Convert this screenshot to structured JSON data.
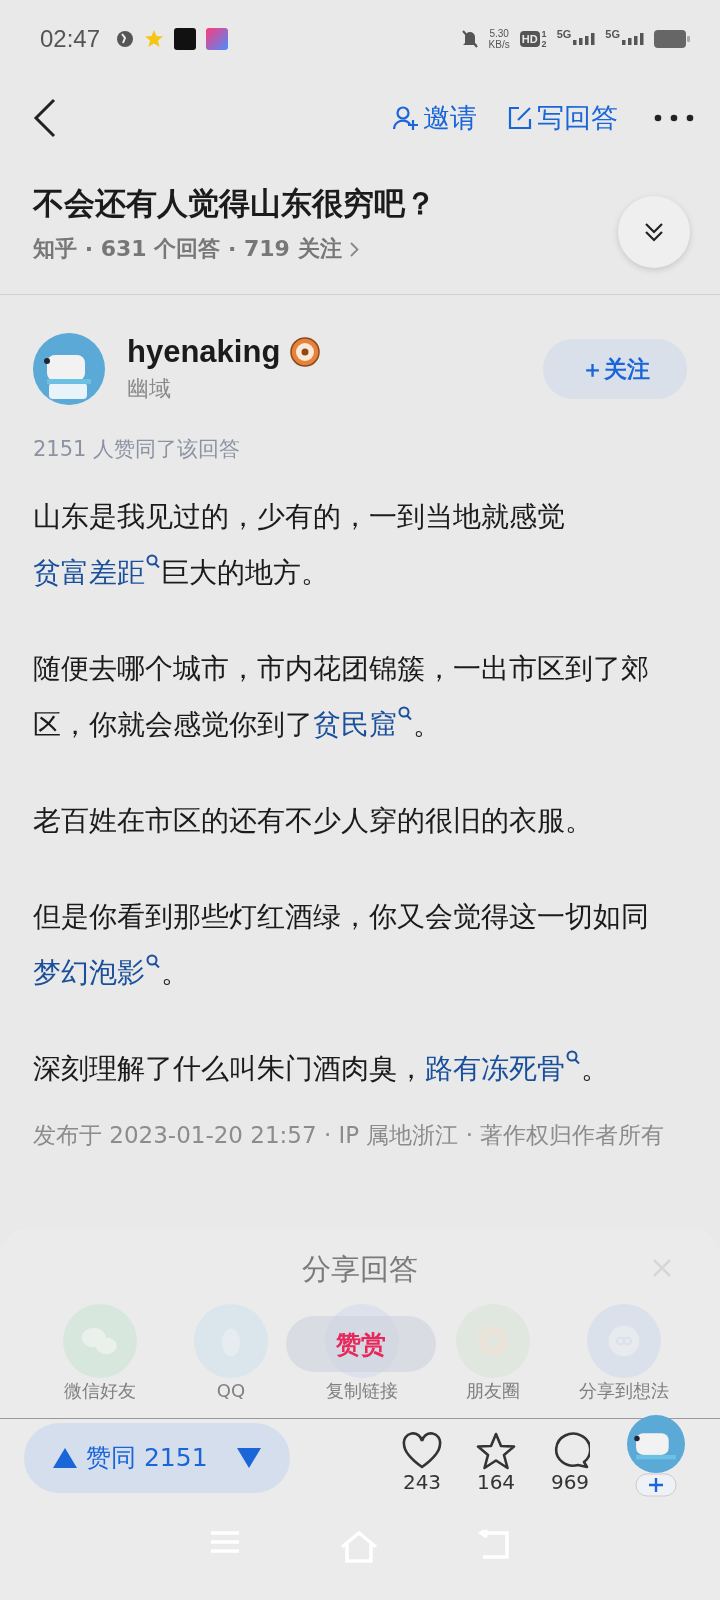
{
  "status_bar": {
    "time": "02:47",
    "speed_value": "5.30",
    "speed_unit": "KB/s",
    "hd_badge": "HD",
    "hd_sims": [
      "1",
      "2"
    ],
    "signals": [
      "5G",
      "5G"
    ]
  },
  "header": {
    "actions": [
      {
        "kind": "invite",
        "label": "邀请"
      },
      {
        "kind": "write",
        "label": "写回答"
      }
    ]
  },
  "question": {
    "title": "不会还有人觉得山东很穷吧？",
    "meta": "知乎 · 631 个回答 · 719 关注"
  },
  "author": {
    "name": "hyenaking",
    "subtitle": "幽域",
    "follow_label": "＋关注"
  },
  "agree_summary": "2151 人赞同了该回答",
  "paragraphs": [
    [
      {
        "text": "山东是我见过的，少有的，一到当地就感觉",
        "link": false
      },
      {
        "text": "贫富差距",
        "link": true
      },
      {
        "text": "巨大的地方。",
        "link": false
      }
    ],
    [
      {
        "text": "随便去哪个城市，市内花团锦簇，一出市区到了郊区，你就会感觉你到了",
        "link": false
      },
      {
        "text": "贫民窟",
        "link": true
      },
      {
        "text": "。",
        "link": false
      }
    ],
    [
      {
        "text": "老百姓在市区的还有不少人穿的很旧的衣服。",
        "link": false
      }
    ],
    [
      {
        "text": "但是你看到那些灯红酒绿，你又会觉得这一切如同",
        "link": false
      },
      {
        "text": "梦幻泡影",
        "link": true
      },
      {
        "text": "。",
        "link": false
      }
    ],
    [
      {
        "text": "深刻理解了什么叫朱门酒肉臭，",
        "link": false
      },
      {
        "text": "路有冻死骨",
        "link": true
      },
      {
        "text": "。",
        "link": false
      }
    ]
  ],
  "post_meta": "发布于 2023-01-20 21:57 · IP 属地浙江 · 著作权归作者所有",
  "share_sheet": {
    "title": "分享回答",
    "targets": [
      {
        "kind": "wechat",
        "label": "微信好友"
      },
      {
        "kind": "qq",
        "label": "QQ"
      },
      {
        "kind": "link",
        "label": "复制链接"
      },
      {
        "kind": "moments",
        "label": "朋友圈"
      },
      {
        "kind": "idea",
        "label": "分享到想法"
      }
    ]
  },
  "reward_label": "赞赏",
  "bottom_bar": {
    "vote_label": "赞同 2151",
    "counts": [
      {
        "kind": "like",
        "count": "243"
      },
      {
        "kind": "favorite",
        "count": "164"
      },
      {
        "kind": "comment",
        "count": "969"
      }
    ]
  }
}
